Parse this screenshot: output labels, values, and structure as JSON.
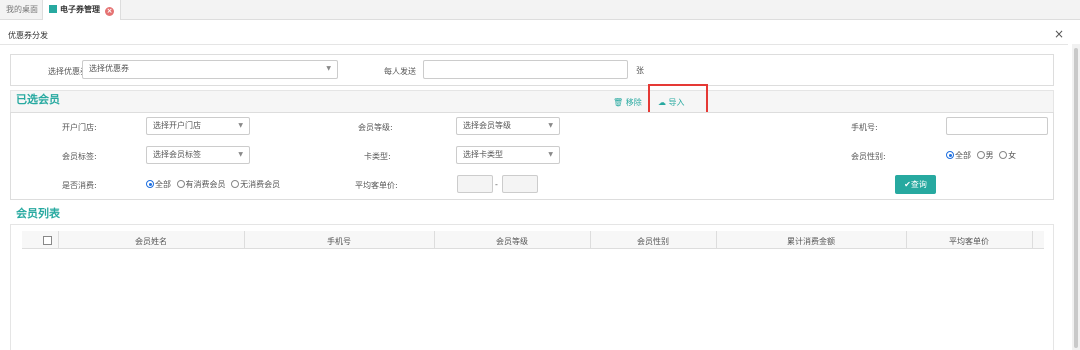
{
  "tabs": [
    {
      "label": "我的桌面"
    },
    {
      "label": "电子券管理"
    }
  ],
  "dialog": {
    "title": "优惠券分发",
    "close": "×"
  },
  "coupon_row": {
    "coupon_label": "选择优惠券:",
    "coupon_value": "选择优惠券",
    "per_person_label": "每人发送",
    "per_person_value": "",
    "unit": "张"
  },
  "selected_members": {
    "heading": "已选会员",
    "remove_label": "移除",
    "import_label": "导入"
  },
  "filters": {
    "store_label": "开户门店:",
    "store_value": "选择开户门店",
    "level_label": "会员等级:",
    "level_value": "选择会员等级",
    "phone_label": "手机号:",
    "phone_value": "",
    "tag_label": "会员标签:",
    "tag_value": "选择会员标签",
    "card_label": "卡类型:",
    "card_value": "选择卡类型",
    "gender_label": "会员性别:",
    "gender_options": [
      "全部",
      "男",
      "女"
    ],
    "gender_selected": "全部",
    "consume_label": "是否消费:",
    "consume_options": [
      "全部",
      "有消费会员",
      "无消费会员"
    ],
    "consume_selected": "全部",
    "avg_label": "平均客单价:",
    "avg_min": "",
    "avg_sep": "-",
    "avg_max": "",
    "query_label": "查询"
  },
  "member_list": {
    "heading": "会员列表",
    "columns": [
      "会员姓名",
      "手机号",
      "会员等级",
      "会员性别",
      "累计消费金额",
      "平均客单价"
    ],
    "rows": []
  },
  "colors": {
    "accent": "#27a9a0",
    "highlight": "#e53935"
  },
  "icons": {
    "remove": "trash-icon",
    "import": "cloud-upload-icon",
    "query": "check-icon",
    "close": "close-icon"
  }
}
